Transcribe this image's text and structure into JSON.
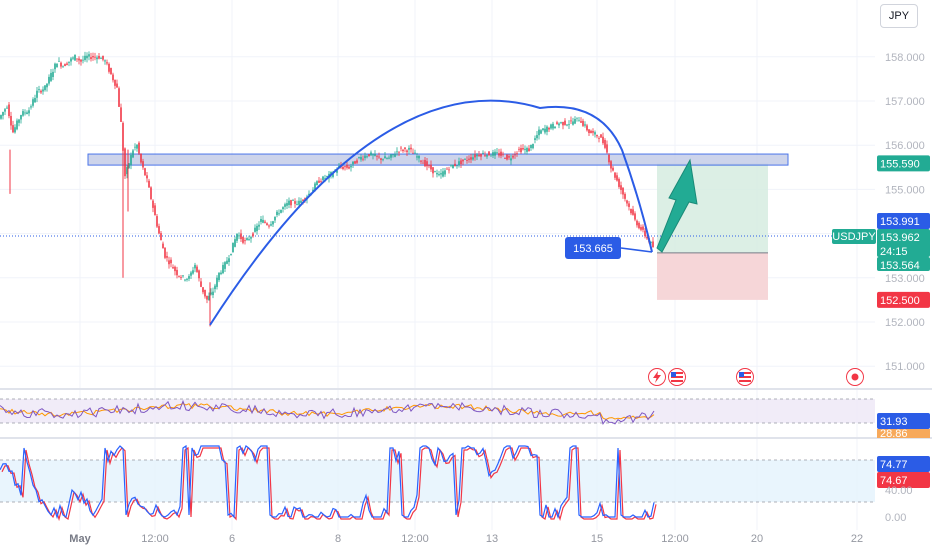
{
  "currency": "JPY",
  "symbol": "USDJPY",
  "price_labels": {
    "current": "153.962",
    "countdown": "24:15",
    "resistance": "155.590",
    "entry": "153.991",
    "stop_zone": "153.564",
    "stop_loss": "152.500",
    "annotation": "153.665"
  },
  "indicators": {
    "rsi_value": "31.93",
    "rsi_signal": "28.86",
    "stoch_k": "74.77",
    "stoch_d": "74.67",
    "stoch_mid": "40.00",
    "stoch_zero": "0.00"
  },
  "colors": {
    "up": "#22ab94",
    "down": "#f23645",
    "line": "#2b5ce6",
    "zone": "#c5cde8",
    "target_fill": "#d6ece0",
    "stop_fill": "#f6d4d6",
    "rsi_line": "#7e57c2",
    "rsi_signal": "#ff9800",
    "stoch_k": "#2962ff",
    "stoch_d": "#f23645"
  },
  "icons": [
    "lightning-icon",
    "us-flag-icon",
    "us-flag-icon",
    "record-icon",
    "arrow-up-icon"
  ],
  "chart_data": {
    "type": "line",
    "title": "",
    "ylabel": "",
    "y_ticks": [
      "158.000",
      "157.000",
      "156.000",
      "155.000",
      "153.000",
      "152.000",
      "151.000"
    ],
    "ylim": [
      150.6,
      158.4
    ],
    "x_ticks": [
      "May",
      "12:00",
      "6",
      "8",
      "12:00",
      "13",
      "15",
      "12:00",
      "20",
      "22"
    ],
    "series": [
      {
        "x": [
          0,
          8,
          14,
          22,
          30,
          38,
          46,
          52,
          58,
          64,
          70,
          76,
          82,
          88,
          94,
          100,
          106,
          112,
          118,
          122,
          126,
          130,
          134,
          138,
          142,
          148,
          154,
          160,
          166,
          172,
          178,
          184,
          190,
          196,
          202,
          208,
          214,
          220,
          226,
          232,
          238,
          246,
          254,
          262,
          270,
          280,
          290,
          300,
          310,
          320,
          330,
          340,
          350,
          360,
          370,
          380,
          390,
          400,
          410,
          420,
          430,
          440,
          450,
          460,
          470,
          480,
          490,
          500,
          510,
          520,
          530,
          540,
          550,
          560,
          570,
          580,
          590,
          600,
          606,
          612,
          618,
          624,
          630,
          636,
          642,
          648,
          654
        ],
        "values": [
          156.6,
          156.9,
          156.3,
          156.7,
          156.8,
          157.2,
          157.3,
          157.6,
          157.9,
          157.8,
          157.9,
          158.0,
          157.9,
          158.0,
          158.0,
          158.0,
          157.9,
          157.6,
          157.3,
          156.5,
          155.3,
          155.6,
          155.9,
          156.0,
          155.6,
          155.2,
          154.6,
          154.0,
          153.5,
          153.3,
          153.1,
          153.0,
          153.0,
          153.3,
          152.8,
          152.5,
          152.7,
          153.1,
          153.3,
          153.6,
          154.0,
          153.8,
          154.0,
          154.3,
          154.2,
          154.5,
          154.7,
          154.7,
          154.9,
          155.2,
          155.3,
          155.5,
          155.5,
          155.7,
          155.8,
          155.7,
          155.7,
          155.9,
          155.9,
          155.7,
          155.5,
          155.3,
          155.5,
          155.6,
          155.7,
          155.8,
          155.8,
          155.8,
          155.7,
          155.9,
          155.9,
          156.3,
          156.4,
          156.5,
          156.5,
          156.6,
          156.3,
          156.2,
          156.0,
          155.5,
          155.2,
          154.9,
          154.6,
          154.3,
          154.1,
          153.9,
          153.7
        ],
        "name": ""
      }
    ],
    "annotations": {
      "horizontal_zone": [
        155.55,
        155.8
      ],
      "trend_curve": "arc",
      "target_zone": [
        153.564,
        155.59
      ],
      "stop_zone": [
        152.5,
        153.564
      ]
    }
  }
}
